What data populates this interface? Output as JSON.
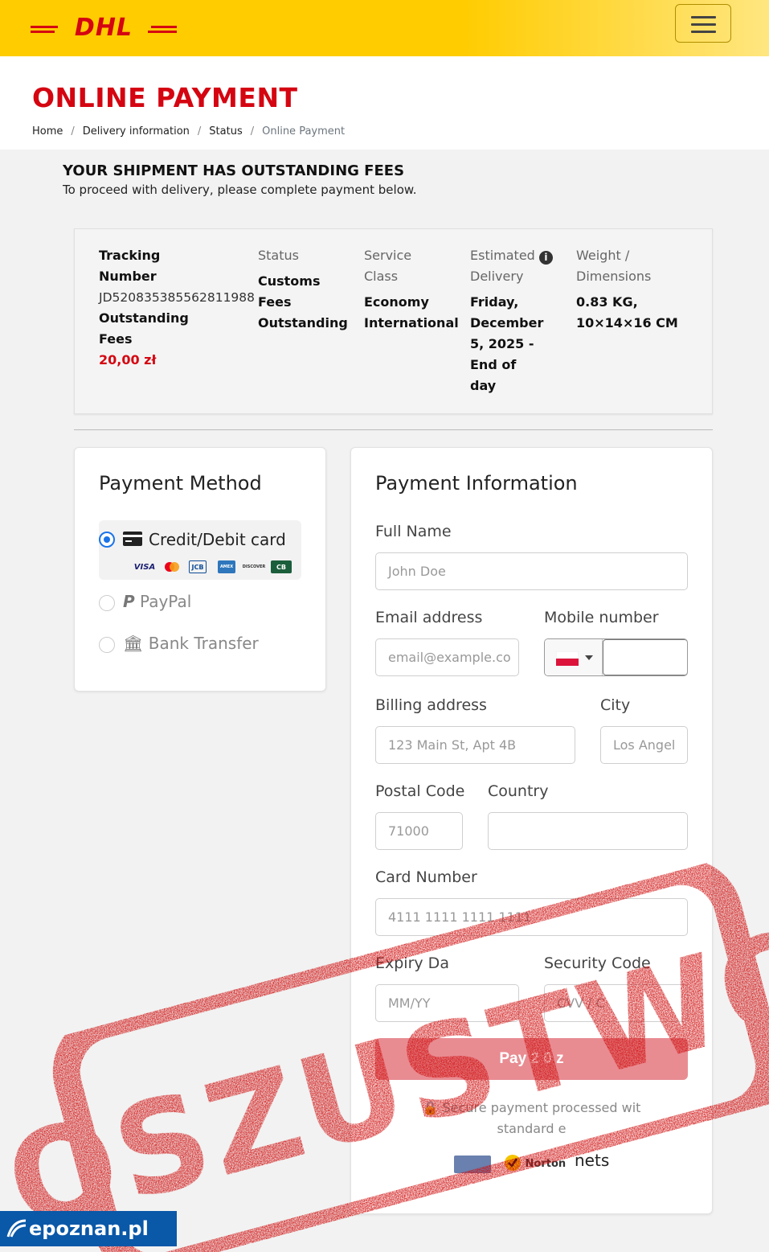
{
  "header": {
    "logo_text": "DHL",
    "menu_icon": "hamburger-icon"
  },
  "page": {
    "title": "ONLINE PAYMENT",
    "breadcrumb": [
      "Home",
      "Delivery information",
      "Status",
      "Online Payment"
    ]
  },
  "notice": {
    "title": "YOUR SHIPMENT HAS OUTSTANDING FEES",
    "subtitle": "To proceed with delivery, please complete payment below."
  },
  "summary": {
    "tracking_label_1": "Tracking",
    "tracking_label_2": "Number",
    "tracking_number": "JD520835385562811988",
    "fees_label_1": "Outstanding",
    "fees_label_2": "Fees",
    "fees_value": "20,00 zł",
    "status_label": "Status",
    "status_value": [
      "Customs",
      "Fees",
      "Outstanding"
    ],
    "service_label": [
      "Service",
      "Class"
    ],
    "service_value": [
      "Economy",
      "International"
    ],
    "delivery_label": [
      "Estimated",
      "Delivery"
    ],
    "delivery_value": [
      "Friday,",
      "December",
      "5, 2025 -",
      "End of",
      "day"
    ],
    "weight_label": [
      "Weight /",
      "Dimensions"
    ],
    "weight_value": [
      "0.83 KG,",
      "10×14×16 CM"
    ]
  },
  "payment_method": {
    "title": "Payment Method",
    "options": [
      {
        "label": "Credit/Debit card",
        "selected": true,
        "icon": "credit-card-icon"
      },
      {
        "label": "PayPal",
        "selected": false,
        "icon": "paypal-icon"
      },
      {
        "label": "Bank Transfer",
        "selected": false,
        "icon": "bank-icon"
      }
    ],
    "card_brands": [
      "VISA",
      "Mastercard",
      "JCB",
      "AMEX",
      "DISCOVER",
      "CB"
    ]
  },
  "payment_info": {
    "title": "Payment Information",
    "full_name": {
      "label": "Full Name",
      "placeholder": "John Doe"
    },
    "email": {
      "label": "Email address",
      "placeholder": "email@example.co"
    },
    "mobile": {
      "label": "Mobile number",
      "country_flag": "Poland"
    },
    "billing": {
      "label": "Billing address",
      "placeholder": "123 Main St, Apt 4B"
    },
    "city": {
      "label": "City",
      "placeholder": "Los Angel"
    },
    "postal": {
      "label": "Postal Code",
      "placeholder": "71000"
    },
    "country": {
      "label": "Country",
      "value": ""
    },
    "card_number": {
      "label": "Card Number",
      "placeholder": "4111 1111 1111 1111"
    },
    "expiry": {
      "label": "Expiry Da",
      "placeholder": "MM/YY"
    },
    "security": {
      "label": "Security Code",
      "placeholder": "CVV / C"
    },
    "pay_button": "Pay 2 0 z",
    "secure_line1": "Secure payment processed wit",
    "secure_line2": "standard e",
    "trust_badges": [
      "Norton",
      "nets"
    ]
  },
  "stamp": {
    "text": "OSZUSTWO",
    "color": "#d01010"
  },
  "watermark": {
    "text": "epoznan.pl"
  },
  "colors": {
    "dhl_yellow": "#ffcc00",
    "dhl_red": "#d40511",
    "selected_blue": "#1a73e8"
  }
}
